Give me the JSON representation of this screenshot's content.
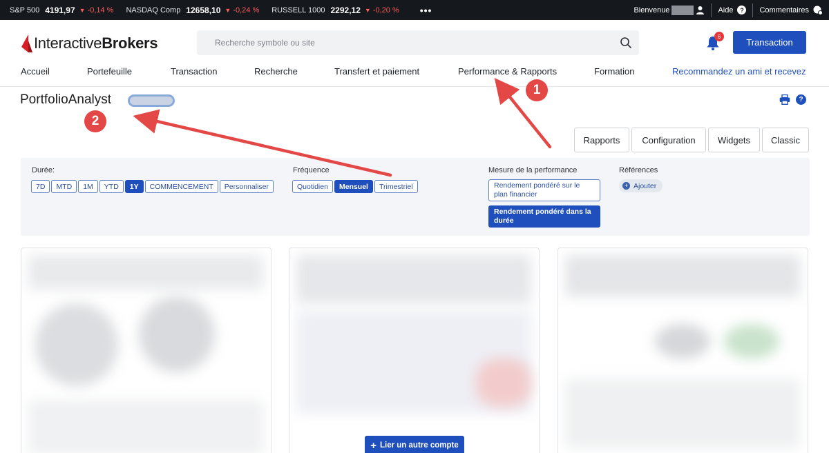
{
  "ticker": {
    "items": [
      {
        "name": "S&P 500",
        "price": "4191,97",
        "change": "-0,14 %"
      },
      {
        "name": "NASDAQ Comp",
        "price": "12658,10",
        "change": "-0,24 %"
      },
      {
        "name": "RUSSELL 1000",
        "price": "2292,12",
        "change": "-0,20 %"
      }
    ],
    "more": "•••",
    "welcome": "Bienvenue",
    "help": "Aide",
    "feedback": "Commentaires"
  },
  "header": {
    "logo_regular_1": "Interactive",
    "logo_bold": "Brokers",
    "search_placeholder": "Recherche symbole ou site",
    "notifications_count": "6",
    "transaction_button": "Transaction"
  },
  "nav": {
    "items": [
      "Accueil",
      "Portefeuille",
      "Transaction",
      "Recherche",
      "Transfert et paiement",
      "Performance & Rapports",
      "Formation"
    ],
    "promo": "Recommandez un ami et recevez"
  },
  "page": {
    "title": "PortfolioAnalyst",
    "view_tabs": [
      "Rapports",
      "Configuration",
      "Widgets",
      "Classic"
    ]
  },
  "filters": {
    "duration_label": "Durée:",
    "durations": [
      "7D",
      "MTD",
      "1M",
      "YTD",
      "1Y",
      "COMMENCEMENT",
      "Personnaliser"
    ],
    "duration_selected": "1Y",
    "frequency_label": "Fréquence",
    "frequencies": [
      "Quotidien",
      "Mensuel",
      "Trimestriel"
    ],
    "frequency_selected": "Mensuel",
    "measure_label": "Mesure de la performance",
    "measure_options": [
      "Rendement pondéré sur le plan financier",
      "Rendement pondéré dans la durée"
    ],
    "measure_selected": "Rendement pondéré dans la durée",
    "references_label": "Références",
    "add_reference": "Ajouter"
  },
  "widgets": {
    "link_account_button": "Lier un autre compte"
  },
  "annotations": {
    "marker_1": "1",
    "marker_2": "2",
    "color": "#e34846"
  },
  "colors": {
    "accent": "#1f4fbd",
    "ticker_bg": "#15181d",
    "negative": "#ff5b5b"
  }
}
